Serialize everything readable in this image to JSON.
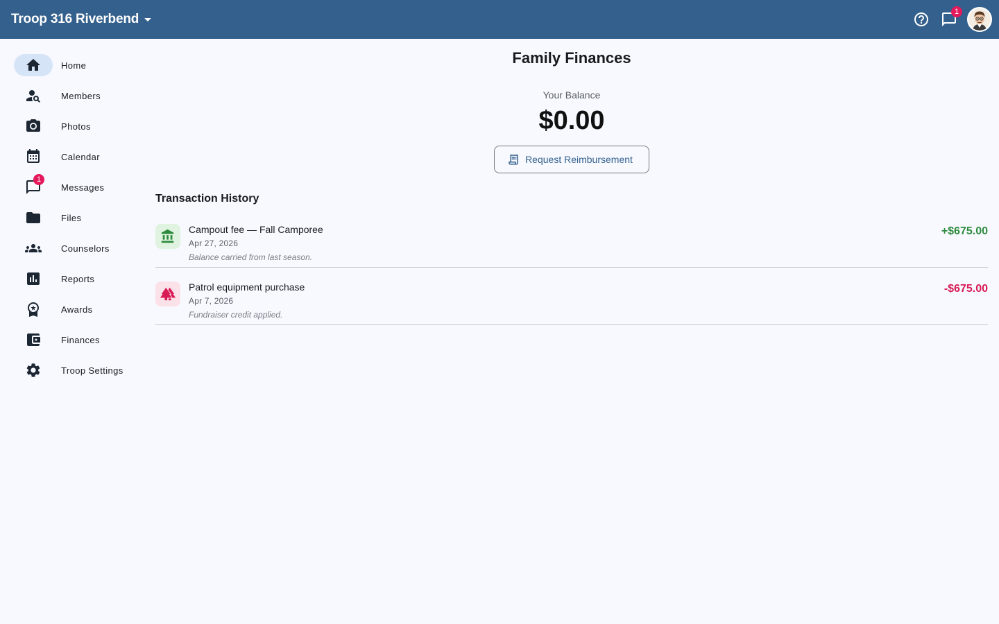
{
  "header": {
    "troop_name": "Troop 316 Riverbend",
    "messages_badge": "1"
  },
  "sidebar": {
    "items": [
      {
        "label": "Home",
        "icon": "home-icon"
      },
      {
        "label": "Members",
        "icon": "person-search-icon"
      },
      {
        "label": "Photos",
        "icon": "camera-icon"
      },
      {
        "label": "Calendar",
        "icon": "calendar-icon"
      },
      {
        "label": "Messages",
        "icon": "chat-icon",
        "badge": "1"
      },
      {
        "label": "Files",
        "icon": "folder-icon"
      },
      {
        "label": "Counselors",
        "icon": "groups-icon"
      },
      {
        "label": "Reports",
        "icon": "bar-chart-icon"
      },
      {
        "label": "Awards",
        "icon": "award-icon"
      },
      {
        "label": "Finances",
        "icon": "wallet-icon"
      },
      {
        "label": "Troop Settings",
        "icon": "gear-icon"
      }
    ],
    "active": "Home"
  },
  "main": {
    "title": "Family Finances",
    "balance_label": "Your Balance",
    "balance_value": "$0.00",
    "request_button": "Request Reimbursement",
    "history_title": "Transaction History",
    "transactions": [
      {
        "title": "Campout fee — Fall Camporee",
        "date": "Apr 27, 2026",
        "note": "Balance carried from last season.",
        "amount": "+$675.00",
        "type": "credit",
        "icon": "bank-icon"
      },
      {
        "title": "Patrol equipment purchase",
        "date": "Apr 7, 2026",
        "note": "Fundraiser credit applied.",
        "amount": "-$675.00",
        "type": "debit",
        "icon": "trees-icon"
      }
    ]
  },
  "colors": {
    "header": "#34608d",
    "credit": "#2e8b3e",
    "debit": "#d81b55",
    "badge": "#e4195c"
  }
}
